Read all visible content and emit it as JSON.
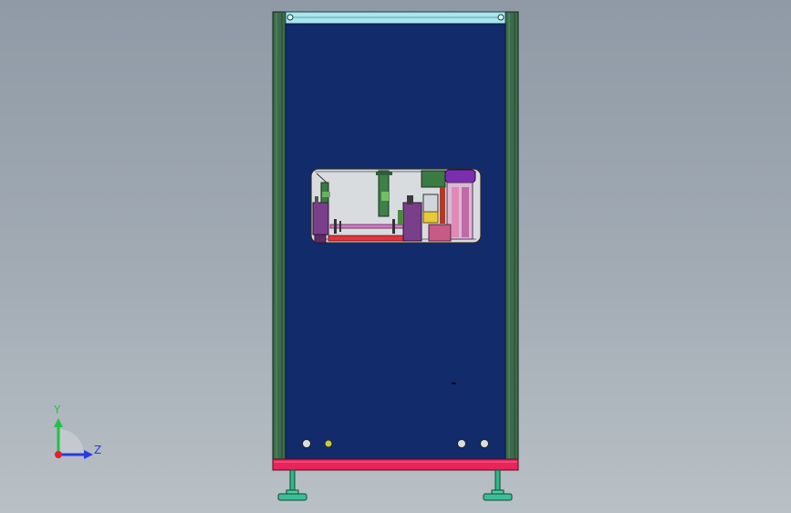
{
  "viewport": {
    "background_top": "#8f9aa6",
    "background_bottom": "#b9c0c6"
  },
  "model": {
    "panel_color": "#112b6b",
    "frame_color": "#3c6b4b",
    "base_color": "#e8245a",
    "top_bar_color": "#a9e6ec"
  },
  "triad": {
    "y_label": "Y",
    "z_label": "Z",
    "y_color": "#22c04a",
    "z_color": "#2a3be0",
    "x_color": "#e0202a"
  }
}
